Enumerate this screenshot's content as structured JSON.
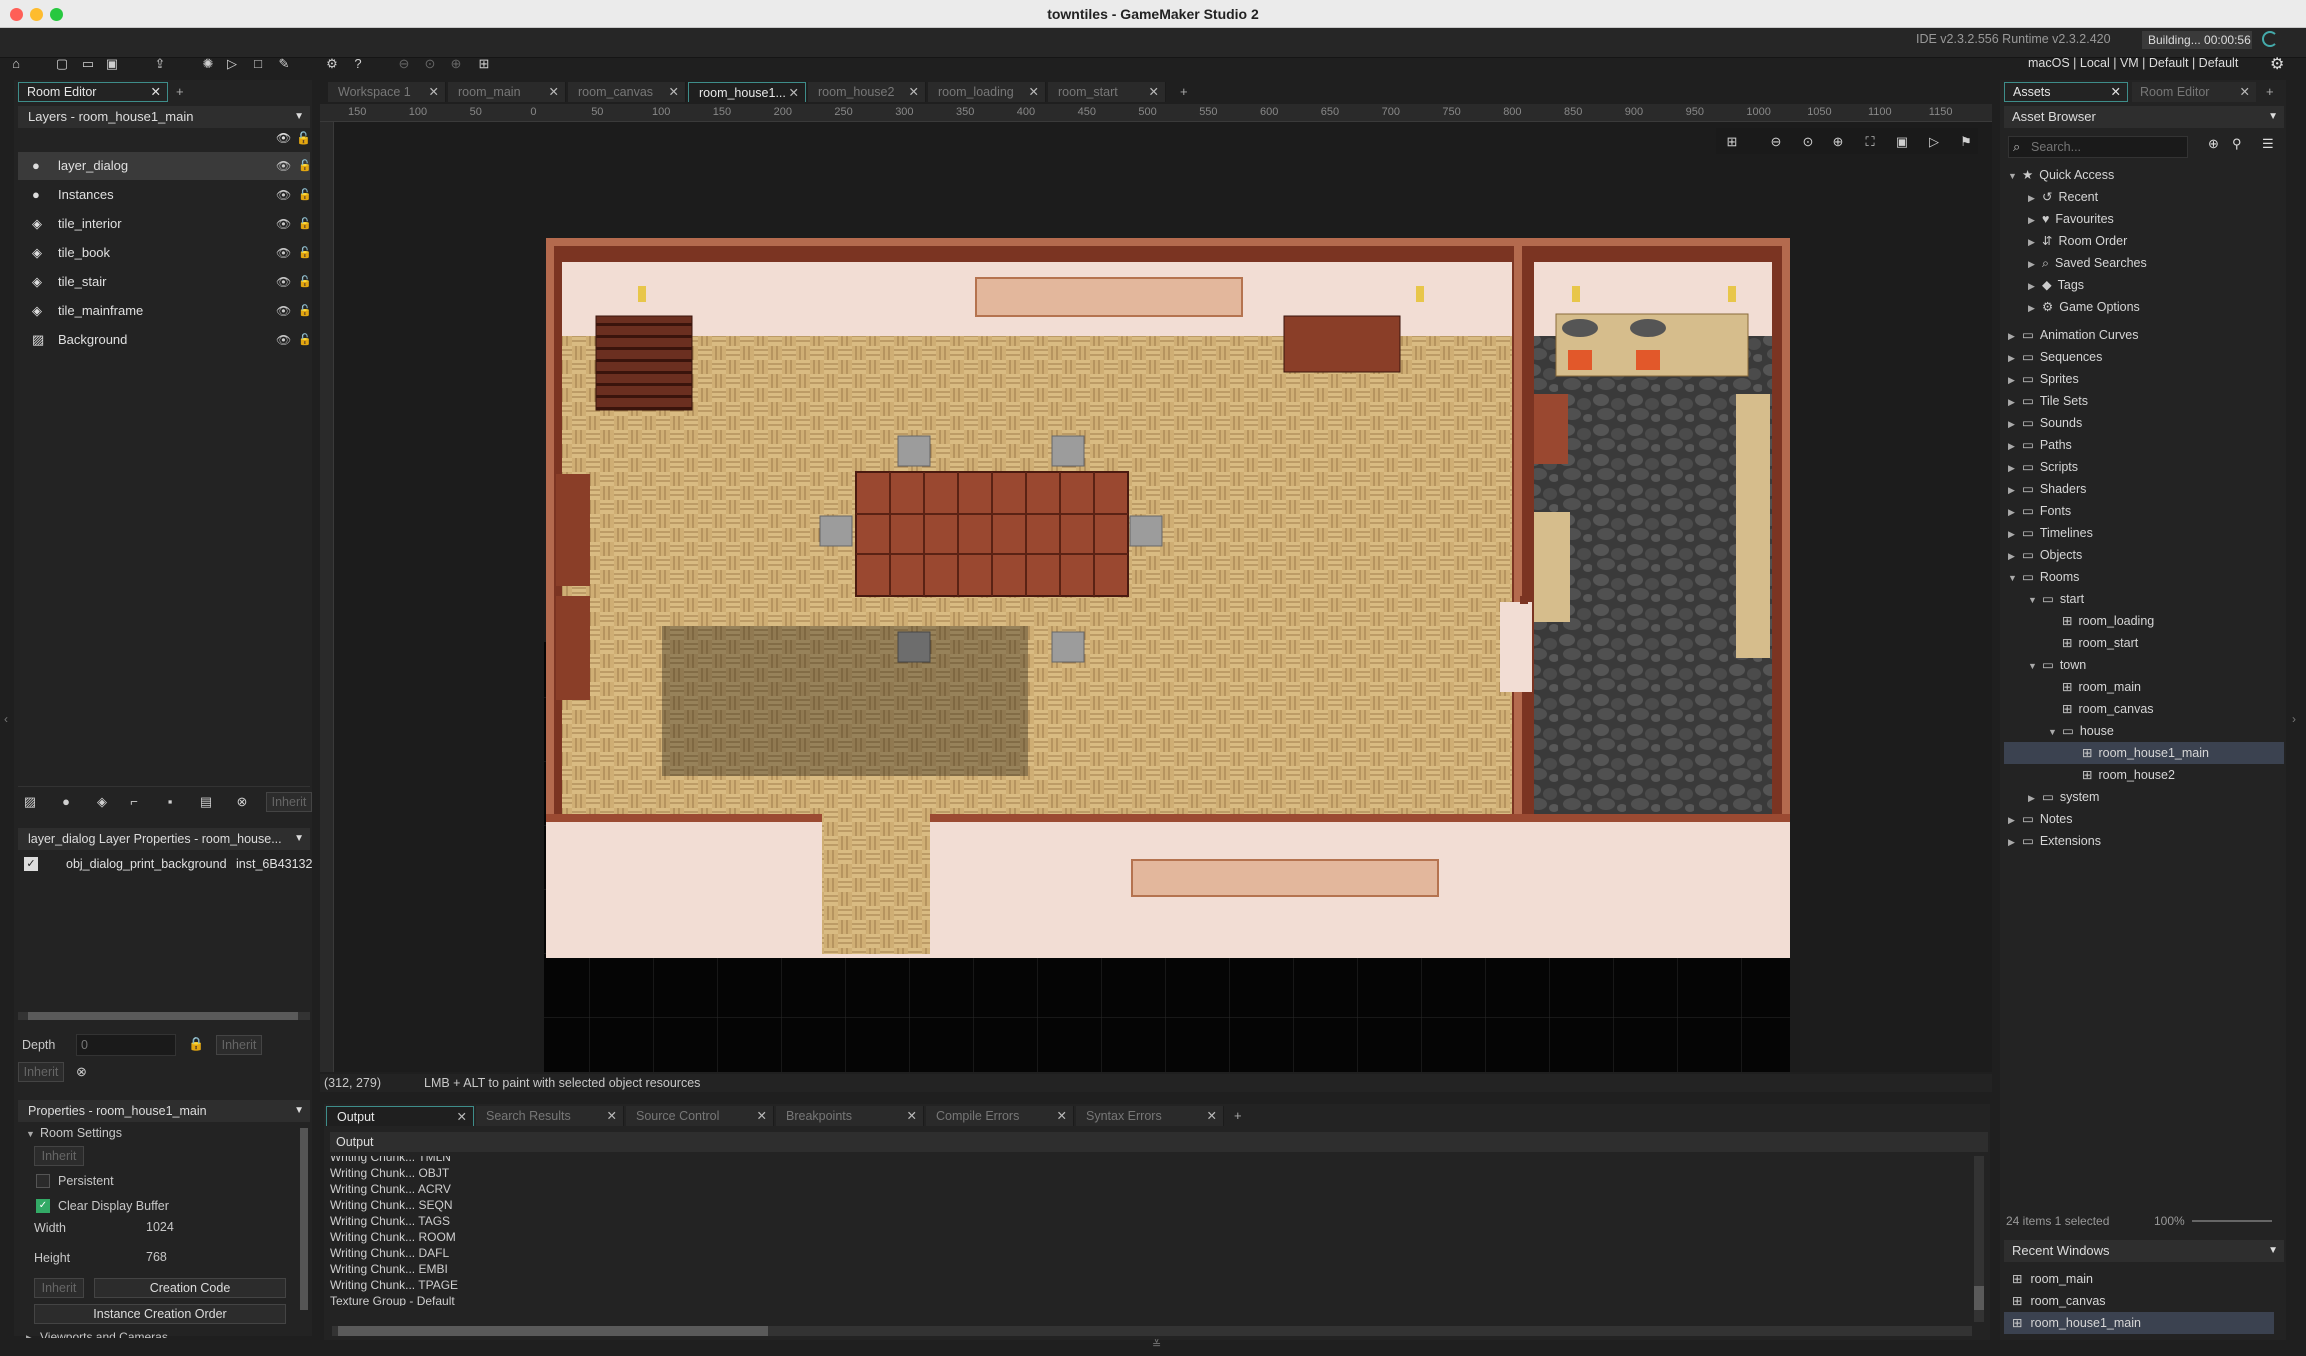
{
  "window": {
    "title": "towntiles - GameMaker Studio 2"
  },
  "status": {
    "version": "IDE v2.3.2.556  Runtime v2.3.2.420",
    "building": "Building... 00:00:56",
    "targets": "macOS | Local | VM | Default | Default"
  },
  "left": {
    "tab": "Room Editor",
    "layers_title": "Layers - room_house1_main",
    "layers": [
      {
        "name": "layer_dialog",
        "type": "instance"
      },
      {
        "name": "Instances",
        "type": "instance"
      },
      {
        "name": "tile_interior",
        "type": "tile"
      },
      {
        "name": "tile_book",
        "type": "tile"
      },
      {
        "name": "tile_stair",
        "type": "tile"
      },
      {
        "name": "tile_mainframe",
        "type": "tile"
      },
      {
        "name": "Background",
        "type": "background"
      }
    ],
    "inherit": "Inherit",
    "layer_props_title": "layer_dialog Layer Properties - room_house...",
    "instance": {
      "object": "obj_dialog_print_background",
      "id": "inst_6B43132"
    },
    "depth_label": "Depth",
    "depth_value": "0",
    "props_title": "Properties - room_house1_main",
    "room_settings": "Room Settings",
    "persistent": "Persistent",
    "clear_display": "Clear Display Buffer",
    "width_label": "Width",
    "width_value": "1024",
    "height_label": "Height",
    "height_value": "768",
    "creation_code": "Creation Code",
    "instance_order": "Instance Creation Order",
    "viewports": "Viewports and Cameras"
  },
  "center": {
    "tabs": [
      "Workspace 1",
      "room_main",
      "room_canvas",
      "room_house1...",
      "room_house2",
      "room_loading",
      "room_start"
    ],
    "ruler": [
      "150",
      "100",
      "50",
      "0",
      "50",
      "100",
      "150",
      "200",
      "250",
      "300",
      "350",
      "400",
      "450",
      "500",
      "550",
      "600",
      "650",
      "700",
      "750",
      "800",
      "850",
      "900",
      "950",
      "1000",
      "1050",
      "1100",
      "1150"
    ],
    "coords": "(312, 279)",
    "hint": "LMB + ALT to paint with selected object resources"
  },
  "output": {
    "tabs": [
      "Output",
      "Search Results",
      "Source Control",
      "Breakpoints",
      "Compile Errors",
      "Syntax Errors"
    ],
    "title": "Output",
    "lines": [
      "Writing Chunk... TMLN",
      "Writing Chunk... OBJT",
      "Writing Chunk... ACRV",
      "Writing Chunk... SEQN",
      "Writing Chunk... TAGS",
      "Writing Chunk... ROOM",
      "Writing Chunk... DAFL",
      "Writing Chunk... EMBI",
      "Writing Chunk... TPAGE",
      "Texture Group - Default"
    ]
  },
  "right": {
    "tabs": [
      "Assets",
      "Room Editor"
    ],
    "browser": "Asset Browser",
    "search_placeholder": "Search...",
    "quick": "Quick Access",
    "quick_items": [
      "Recent",
      "Favourites",
      "Room Order",
      "Saved Searches",
      "Tags",
      "Game Options"
    ],
    "folders": [
      "Animation Curves",
      "Sequences",
      "Sprites",
      "Tile Sets",
      "Sounds",
      "Paths",
      "Scripts",
      "Shaders",
      "Fonts",
      "Timelines",
      "Objects"
    ],
    "rooms": "Rooms",
    "start": "start",
    "start_items": [
      "room_loading",
      "room_start"
    ],
    "town": "town",
    "town_items": [
      "room_main",
      "room_canvas"
    ],
    "house": "house",
    "house_items": [
      "room_house1_main",
      "room_house2"
    ],
    "system": "system",
    "tail": [
      "Notes",
      "Extensions"
    ],
    "count": "24 items   1 selected",
    "zoom": "100%",
    "recent_title": "Recent Windows",
    "recent": [
      "room_main",
      "room_canvas",
      "room_house1_main"
    ]
  }
}
